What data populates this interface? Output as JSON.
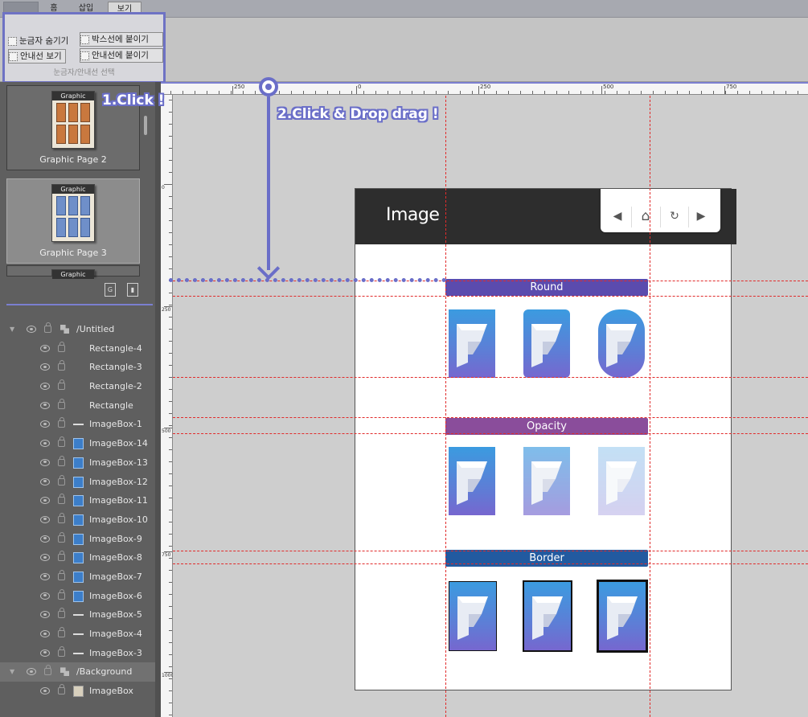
{
  "ribbon": {
    "tabs": [
      "",
      "홈",
      "삽입",
      "보기"
    ],
    "buttons": {
      "hide_ruler": "눈금자 숨기기",
      "show_guide": "안내선 보기",
      "snap_box": "박스선에 붙이기",
      "snap_guide": "안내선에 붙이기"
    },
    "group_caption": "눈금자/안내선 선택"
  },
  "pages": [
    {
      "label": "Graphic Page 2",
      "thumb_label": "Graphic"
    },
    {
      "label": "Graphic Page 3",
      "thumb_label": "Graphic"
    },
    {
      "thumb_label": "Graphic"
    }
  ],
  "layers": [
    {
      "name": "/Untitled",
      "type": "folder"
    },
    {
      "name": "Rectangle-4",
      "type": "rect"
    },
    {
      "name": "Rectangle-3",
      "type": "rect"
    },
    {
      "name": "Rectangle-2",
      "type": "rect"
    },
    {
      "name": "Rectangle",
      "type": "rect"
    },
    {
      "name": "ImageBox-1",
      "type": "line"
    },
    {
      "name": "ImageBox-14",
      "type": "image"
    },
    {
      "name": "ImageBox-13",
      "type": "image"
    },
    {
      "name": "ImageBox-12",
      "type": "image"
    },
    {
      "name": "ImageBox-11",
      "type": "image"
    },
    {
      "name": "ImageBox-10",
      "type": "image"
    },
    {
      "name": "ImageBox-9",
      "type": "image"
    },
    {
      "name": "ImageBox-8",
      "type": "image"
    },
    {
      "name": "ImageBox-7",
      "type": "image"
    },
    {
      "name": "ImageBox-6",
      "type": "image"
    },
    {
      "name": "ImageBox-5",
      "type": "line"
    },
    {
      "name": "ImageBox-4",
      "type": "line"
    },
    {
      "name": "ImageBox-3",
      "type": "line"
    },
    {
      "name": "/Background",
      "type": "folder"
    },
    {
      "name": "ImageBox",
      "type": "page"
    }
  ],
  "ruler": {
    "h_labels": [
      "250",
      "0",
      "250",
      "500",
      "750"
    ],
    "v_labels": [
      "0",
      "250",
      "500",
      "750",
      "1000"
    ]
  },
  "canvas": {
    "title": "Image",
    "sections": {
      "round": "Round",
      "opacity": "Opacity",
      "border": "Border"
    },
    "image_opacity": [
      1.0,
      0.65,
      0.3
    ],
    "border_widths": [
      1,
      2,
      3
    ]
  },
  "annotations": {
    "step1": "1.Click !",
    "step2": "2.Click & Drop drag !"
  },
  "colors": {
    "accent": "#6a6ec8",
    "guide": "#e12b2b",
    "round_bar": "#5b4bae",
    "opacity_bar": "#8a4d9b",
    "border_bar": "#225aa0"
  }
}
